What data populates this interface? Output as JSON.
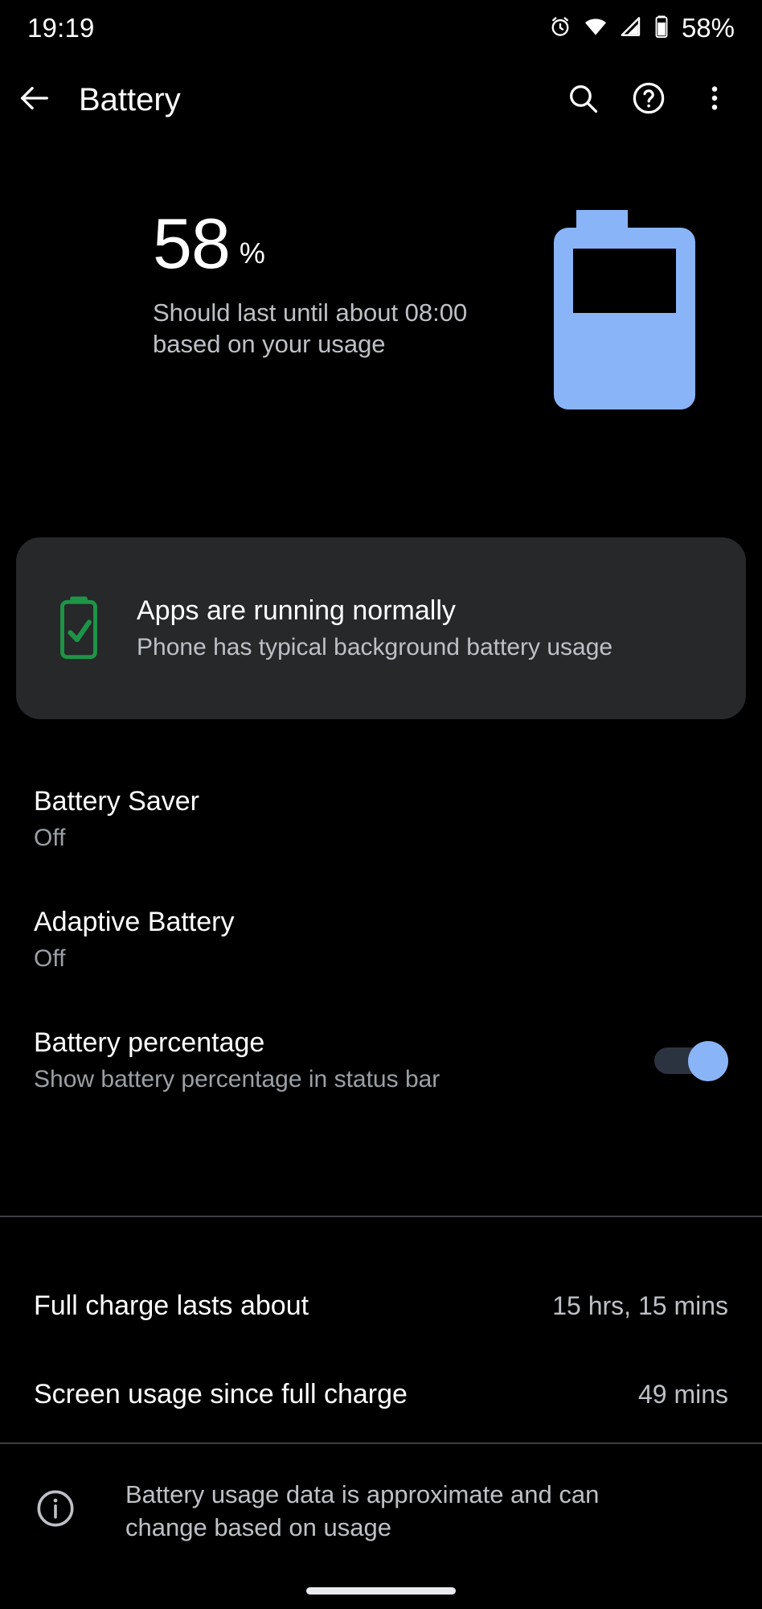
{
  "status_bar": {
    "time": "19:19",
    "battery_percent_label": "58%",
    "icons": [
      "alarm-icon",
      "wifi-icon",
      "cellular-signal-icon",
      "battery-icon"
    ]
  },
  "toolbar": {
    "title": "Battery",
    "back_icon": "back-arrow-icon",
    "search_icon": "search-icon",
    "help_icon": "help-circle-icon",
    "overflow_icon": "more-vertical-icon"
  },
  "header": {
    "percent": "58",
    "percent_unit": "%",
    "estimate": "Should last until about 08:00 based on your usage",
    "battery_graphic_icon": "battery-level-graphic",
    "battery_level_fraction": 0.58,
    "accent_color": "#8ab4f8"
  },
  "status_card": {
    "icon": "battery-check-icon",
    "icon_color": "#1e9447",
    "title": "Apps are running normally",
    "subtitle": "Phone has typical background battery usage",
    "background_color": "#26282a"
  },
  "preferences": [
    {
      "title": "Battery Saver",
      "summary": "Off"
    },
    {
      "title": "Adaptive Battery",
      "summary": "Off"
    },
    {
      "title": "Battery percentage",
      "summary": "Show battery percentage in status bar",
      "toggle": "on"
    }
  ],
  "stats": [
    {
      "label": "Full charge lasts about",
      "value": "15 hrs, 15 mins"
    },
    {
      "label": "Screen usage since full charge",
      "value": "49 mins"
    }
  ],
  "footer": {
    "icon": "info-circle-icon",
    "note": "Battery usage data is approximate and can change based on usage"
  }
}
